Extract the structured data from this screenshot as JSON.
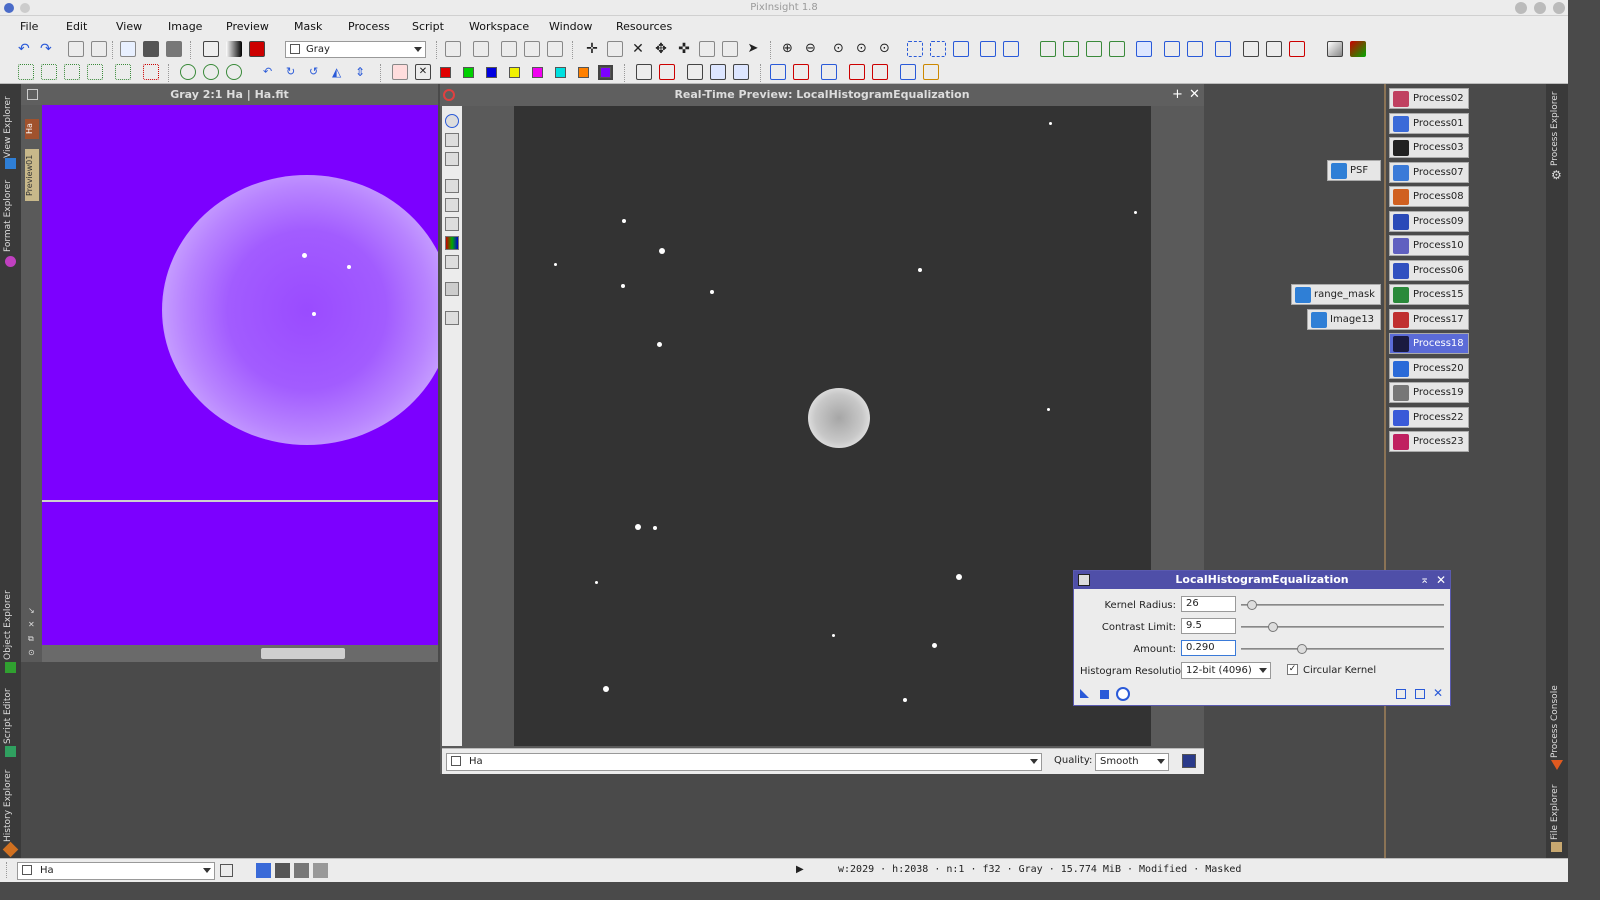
{
  "app": {
    "title": "PixInsight 1.8"
  },
  "menu": [
    "File",
    "Edit",
    "View",
    "Image",
    "Preview",
    "Mask",
    "Process",
    "Script",
    "Workspace",
    "Window",
    "Resources"
  ],
  "toolbar": {
    "channel_combo": "Gray"
  },
  "left_dock": {
    "tabs": [
      "View Explorer",
      "Format Explorer",
      "Object Explorer",
      "Script Editor",
      "History Explorer"
    ]
  },
  "right_dock": {
    "tabs": [
      "Process Explorer",
      "Process Console",
      "File Explorer"
    ]
  },
  "image_window": {
    "title": "Gray 2:1 Ha | Ha.fit",
    "side_tabs": [
      "Ha",
      "Preview01"
    ]
  },
  "preview_window": {
    "title": "Real-Time Preview: LocalHistogramEqualization",
    "view_combo": "Ha",
    "quality_label": "Quality:",
    "quality_value": "Smooth"
  },
  "lhe_dialog": {
    "title": "LocalHistogramEqualization",
    "kernel_radius_label": "Kernel Radius:",
    "kernel_radius": "26",
    "contrast_limit_label": "Contrast Limit:",
    "contrast_limit": "9.5",
    "amount_label": "Amount:",
    "amount": "0.290",
    "hist_res_label": "Histogram Resolution:",
    "hist_res": "12-bit (4096)",
    "circular_kernel_label": "Circular Kernel",
    "circular_kernel_checked": true,
    "kernel_radius_slider": 0.03,
    "contrast_limit_slider": 0.14,
    "amount_slider": 0.29
  },
  "process_icons": [
    {
      "label": "Process02",
      "color": "#c04060"
    },
    {
      "label": "Process01",
      "color": "#3a6ad8"
    },
    {
      "label": "Process03",
      "color": "#222222"
    },
    {
      "label": "Process07",
      "color": "#3a7ad8"
    },
    {
      "label": "Process08",
      "color": "#d06020"
    },
    {
      "label": "Process09",
      "color": "#2a4ab8"
    },
    {
      "label": "Process10",
      "color": "#6060c0"
    },
    {
      "label": "Process06",
      "color": "#3050c0"
    },
    {
      "label": "Process15",
      "color": "#2a8a3a"
    },
    {
      "label": "Process17",
      "color": "#c03030"
    },
    {
      "label": "Process18",
      "color": "#1a1a40",
      "selected": true
    },
    {
      "label": "Process20",
      "color": "#2a6ad8"
    },
    {
      "label": "Process19",
      "color": "#777777"
    },
    {
      "label": "Process22",
      "color": "#3a5ad8"
    },
    {
      "label": "Process23",
      "color": "#c02060"
    }
  ],
  "desktop_icons": [
    "PSF",
    "range_mask",
    "Image13"
  ],
  "statusbar": {
    "view": "Ha",
    "info": "w:2029 · h:2038 · n:1 · f32 · Gray · 15.774 MiB · Modified · Masked"
  }
}
